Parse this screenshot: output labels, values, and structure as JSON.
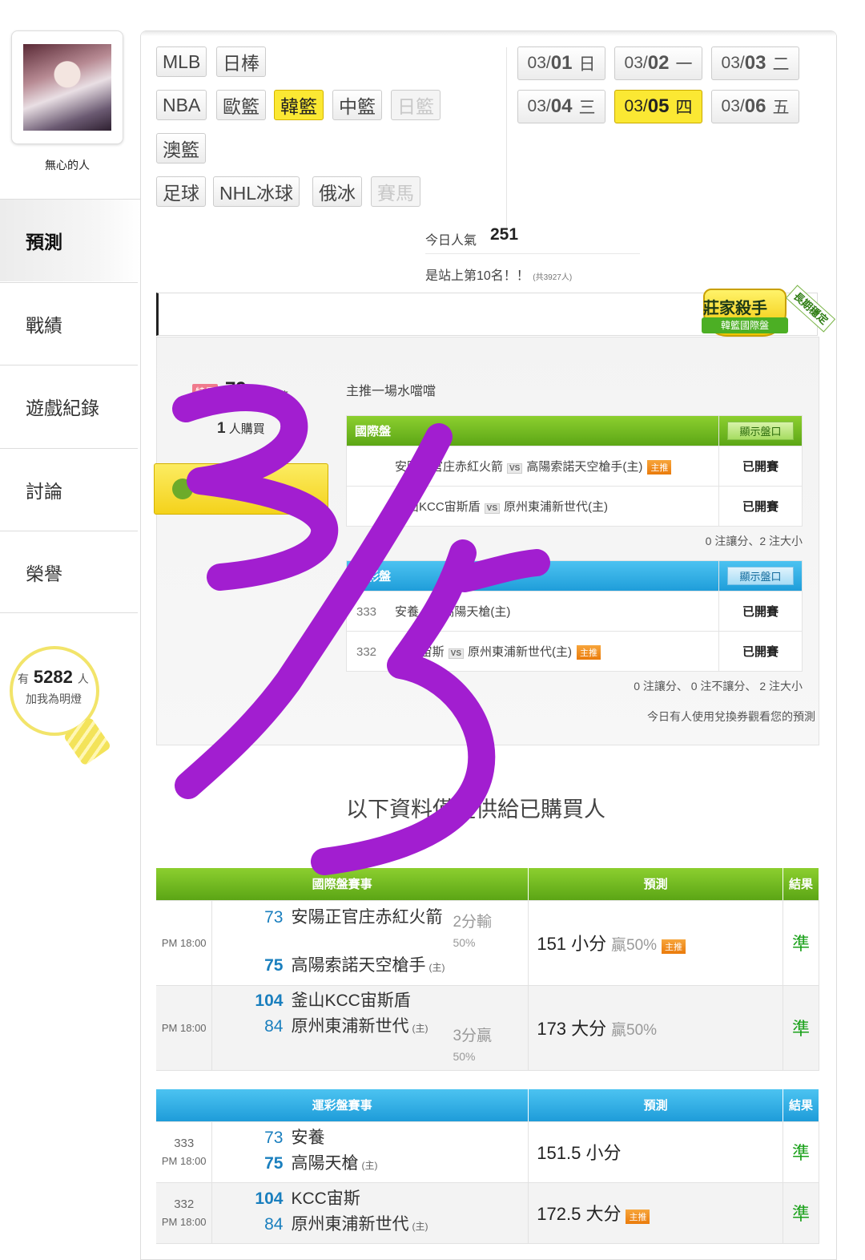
{
  "user": {
    "name": "無心的人",
    "fans_prefix": "有",
    "fans_count": "5282",
    "fans_suffix": "人",
    "fans_caption": "加我為明燈"
  },
  "nav": {
    "items": [
      {
        "label": "預測",
        "active": true
      },
      {
        "label": "戰績"
      },
      {
        "label": "遊戲紀錄"
      },
      {
        "label": "討論"
      },
      {
        "label": "榮譽"
      }
    ]
  },
  "sports": [
    "MLB",
    "日棒",
    "NBA",
    "歐籃",
    "韓籃",
    "中籃",
    "日籃",
    "澳籃",
    "足球",
    "NHL冰球",
    "俄冰",
    "賽馬"
  ],
  "dates": [
    {
      "prefix": "03/",
      "day": "01",
      "weekday": "日"
    },
    {
      "prefix": "03/",
      "day": "02",
      "weekday": "一"
    },
    {
      "prefix": "03/",
      "day": "03",
      "weekday": "二"
    },
    {
      "prefix": "03/",
      "day": "04",
      "weekday": "三"
    },
    {
      "prefix": "03/",
      "day": "05",
      "weekday": "四"
    },
    {
      "prefix": "03/",
      "day": "06",
      "weekday": "五"
    }
  ],
  "popularity": {
    "label": "今日人氣",
    "value": "251",
    "rank_text": "是站上第10名！！",
    "rank_sub": "(共3927人)"
  },
  "badge": {
    "title": "莊家殺手",
    "subtitle": "韓籃國際盤",
    "tag": "長期穩定"
  },
  "purchase": {
    "price_tag": "特價",
    "price": "79",
    "price_unit": "鑽幣",
    "buyers_count": "1",
    "buyers_label": "人購買",
    "tagline": "主推一場水噹噹"
  },
  "intl_panel": {
    "title": "國際盤",
    "show_button": "顯示盤口",
    "rows": [
      {
        "home": "安陽正官庄赤紅火箭",
        "away": "高陽索諾天空槍手(主)",
        "vs": "VS",
        "star": "主推",
        "status": "已開賽"
      },
      {
        "home": "釜山KCC宙斯盾",
        "away": "原州東浦新世代(主)",
        "vs": "VS",
        "status": "已開賽"
      }
    ],
    "summary": "0 注讓分、2 注大小"
  },
  "lottery_panel": {
    "title": "運彩盤",
    "show_button": "顯示盤口",
    "rows": [
      {
        "num": "333",
        "home": "安養",
        "away": "高陽天槍(主)",
        "vs": "VS",
        "status": "已開賽"
      },
      {
        "num": "332",
        "home": "KCC宙斯",
        "away": "原州東浦新世代(主)",
        "vs": "VS",
        "star": "主推",
        "status": "已開賽"
      }
    ],
    "summary": "0 注讓分、 0 注不讓分、 2 注大小"
  },
  "notice": "今日有人使用兌換券觀看您的預測",
  "section_title": "以下資料僅提供給已購買人",
  "intl_results": {
    "headers": [
      "國際盤賽事",
      "預測",
      "結果"
    ],
    "rows": [
      {
        "time": "PM 18:00",
        "teams": [
          {
            "num": "73",
            "name": "安陽正官庄赤紅火箭"
          },
          {
            "num": "75",
            "name": "高陽索諾天空槍手",
            "home": "(主)"
          }
        ],
        "spread_a": "2分輸",
        "spread_b": "50%",
        "pred": "151 小分",
        "win": "贏50%",
        "star": "主推",
        "result": "準"
      },
      {
        "time": "PM 18:00",
        "teams": [
          {
            "num": "104",
            "name": "釜山KCC宙斯盾"
          },
          {
            "num": "84",
            "name": "原州東浦新世代",
            "home": "(主)"
          }
        ],
        "spread_a": "3分贏",
        "spread_b": "50%",
        "pred": "173 大分",
        "win": "贏50%",
        "result": "準"
      }
    ]
  },
  "lottery_results": {
    "headers": [
      "運彩盤賽事",
      "預測",
      "結果"
    ],
    "rows": [
      {
        "num": "333",
        "time": "PM 18:00",
        "teams": [
          {
            "num": "73",
            "name": "安養"
          },
          {
            "num": "75",
            "name": "高陽天槍",
            "home": "(主)"
          }
        ],
        "pred": "151.5 小分",
        "result": "準"
      },
      {
        "num": "332",
        "time": "PM 18:00",
        "teams": [
          {
            "num": "104",
            "name": "KCC宙斯"
          },
          {
            "num": "84",
            "name": "原州東浦新世代",
            "home": "(主)"
          }
        ],
        "pred": "172.5 大分",
        "star": "主推",
        "result": "準"
      }
    ]
  },
  "handwriting": {
    "text": "3/5",
    "color": "#a21ed0"
  }
}
